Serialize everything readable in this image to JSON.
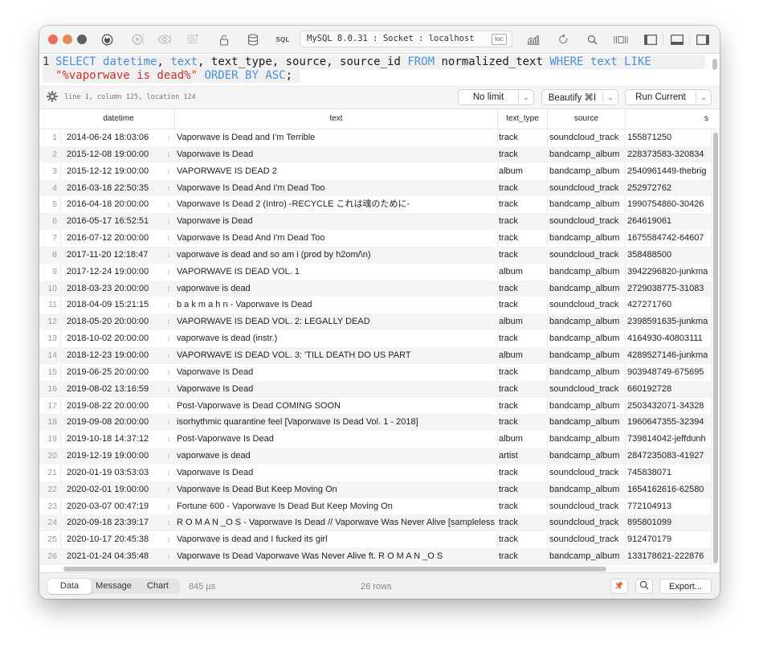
{
  "toolbar": {
    "connection": "MySQL 8.0.31 : Socket : localhost",
    "connection_badge": "loc",
    "sql_label": "SQL",
    "icons": [
      "plug-icon",
      "close-circle-icon",
      "eye-icon",
      "sort-lines-icon",
      "lock-icon",
      "database-icon",
      "sql-icon",
      "chart-icon",
      "refresh-icon",
      "search-icon",
      "columns-icon",
      "left-panel-icon",
      "bottom-panel-icon",
      "right-panel-icon"
    ],
    "accent_colors": {
      "close": "#ec6a5e",
      "minimize": "#e8875a",
      "maximize": "#5f5f5f"
    }
  },
  "editor": {
    "line_number": "1",
    "query_line1": [
      {
        "t": "SELECT",
        "k": "kw"
      },
      {
        "t": " "
      },
      {
        "t": "datetime",
        "k": "kw"
      },
      {
        "t": ", "
      },
      {
        "t": "text",
        "k": "kw"
      },
      {
        "t": ", text_type, source, source_id "
      },
      {
        "t": "FROM",
        "k": "kw"
      },
      {
        "t": " normalized_text "
      },
      {
        "t": "WHERE",
        "k": "kw"
      },
      {
        "t": " "
      },
      {
        "t": "text",
        "k": "kw"
      },
      {
        "t": " "
      },
      {
        "t": "LIKE",
        "k": "kw"
      }
    ],
    "query_line2": [
      {
        "t": "\"%vaporwave is dead%\"",
        "k": "str"
      },
      {
        "t": " "
      },
      {
        "t": "ORDER BY",
        "k": "kw"
      },
      {
        "t": " "
      },
      {
        "t": "ASC",
        "k": "kw"
      },
      {
        "t": ";"
      }
    ],
    "cursor_info": "line 1, column 125, location 124"
  },
  "actions": {
    "limit": "No limit",
    "beautify": "Beautify ⌘I",
    "run": "Run Current"
  },
  "table": {
    "columns": [
      "datetime",
      "text",
      "text_type",
      "source",
      "s"
    ],
    "rows": [
      [
        "1",
        "2014-06-24 18:03:06",
        "Vaporwave is Dead and I'm Terrible",
        "track",
        "soundcloud_track",
        "155871250"
      ],
      [
        "2",
        "2015-12-08 19:00:00",
        "Vaporwave Is Dead",
        "track",
        "bandcamp_album",
        "228373583-320834"
      ],
      [
        "3",
        "2015-12-12 19:00:00",
        "VAPORWAVE IS DEAD 2",
        "album",
        "bandcamp_album",
        "2540961449-thebrig"
      ],
      [
        "4",
        "2016-03-18 22:50:35",
        "Vaporwave Is Dead And I'm Dead Too",
        "track",
        "soundcloud_track",
        "252972762"
      ],
      [
        "5",
        "2016-04-18 20:00:00",
        "Vaporwave Is Dead 2 (Intro) -RECYCLE これは魂のために-",
        "track",
        "bandcamp_album",
        "1990754860-30426"
      ],
      [
        "6",
        "2016-05-17 16:52:51",
        "Vaporwave is Dead",
        "track",
        "soundcloud_track",
        "264619061"
      ],
      [
        "7",
        "2016-07-12 20:00:00",
        "Vaporwave Is Dead And I'm Dead Too",
        "track",
        "bandcamp_album",
        "1675584742-64607"
      ],
      [
        "8",
        "2017-11-20 12:18:47",
        "vaporwave is dead and so am i (prod by h2om/\\n)",
        "track",
        "soundcloud_track",
        "358488500"
      ],
      [
        "9",
        "2017-12-24 19:00:00",
        "VAPORWAVE IS DEAD VOL. 1",
        "album",
        "bandcamp_album",
        "3942296820-junkma"
      ],
      [
        "10",
        "2018-03-23 20:00:00",
        "vaporwave is dead",
        "track",
        "bandcamp_album",
        "2729038775-31083"
      ],
      [
        "11",
        "2018-04-09 15:21:15",
        "b a k m a h n - Vaporwave Is Dead",
        "track",
        "soundcloud_track",
        "427271760"
      ],
      [
        "12",
        "2018-05-20 20:00:00",
        "VAPORWAVE IS DEAD VOL. 2: LEGALLY DEAD",
        "album",
        "bandcamp_album",
        "2398591635-junkma"
      ],
      [
        "13",
        "2018-10-02 20:00:00",
        "vaporwave is dead (instr.)",
        "track",
        "bandcamp_album",
        "4164930-40803111"
      ],
      [
        "14",
        "2018-12-23 19:00:00",
        "VAPORWAVE IS DEAD VOL. 3: 'TILL DEATH DO US PART",
        "album",
        "bandcamp_album",
        "4289527146-junkma"
      ],
      [
        "15",
        "2019-06-25 20:00:00",
        "Vaporwave Is Dead",
        "track",
        "bandcamp_album",
        "903948749-675695"
      ],
      [
        "16",
        "2019-08-02 13:16:59",
        "Vaporwave Is Dead",
        "track",
        "soundcloud_track",
        "660192728"
      ],
      [
        "17",
        "2019-08-22 20:00:00",
        "Post-Vaporwave is Dead COMING SOON",
        "track",
        "bandcamp_album",
        "2503432071-34328"
      ],
      [
        "18",
        "2019-09-08 20:00:00",
        "isorhythmic quarantine feel [Vaporwave Is Dead Vol. 1 - 2018]",
        "track",
        "bandcamp_album",
        "1960647355-32394"
      ],
      [
        "19",
        "2019-10-18 14:37:12",
        "Post-Vaporwave Is Dead",
        "album",
        "bandcamp_album",
        "739814042-jeffdunh"
      ],
      [
        "20",
        "2019-12-19 19:00:00",
        "vaporwave is dead",
        "artist",
        "bandcamp_album",
        "2847235083-41927"
      ],
      [
        "21",
        "2020-01-19 03:53:03",
        "Vaporwave Is Dead",
        "track",
        "soundcloud_track",
        "745838071"
      ],
      [
        "22",
        "2020-02-01 19:00:00",
        "Vaporwave Is Dead But Keep Moving On",
        "track",
        "bandcamp_album",
        "1654162616-62580"
      ],
      [
        "23",
        "2020-03-07 00:47:19",
        "Fortune 600 - Vaporwave Is Dead But Keep Moving On",
        "track",
        "soundcloud_track",
        "772104913"
      ],
      [
        "24",
        "2020-09-18 23:39:17",
        "R O M A N _O S - Vaporwave Is Dead // Vaporwave Was Never Alive [sampleless]",
        "track",
        "soundcloud_track",
        "895801099"
      ],
      [
        "25",
        "2020-10-17 20:45:38",
        "Vaporwave is dead and I fucked its girl",
        "track",
        "soundcloud_track",
        "912470179"
      ],
      [
        "26",
        "2021-01-24 04:35:48",
        "Vaporwave Is Dead Vaporwave Was Never Alive ft. R O M A N _O S",
        "track",
        "bandcamp_album",
        "133178621-222876"
      ]
    ]
  },
  "footer": {
    "tabs": [
      "Data",
      "Message",
      "Chart"
    ],
    "active_tab": "Data",
    "exec_time": "845 µs",
    "row_count": "26 rows",
    "export": "Export...",
    "pin_color": "#e8643c"
  }
}
